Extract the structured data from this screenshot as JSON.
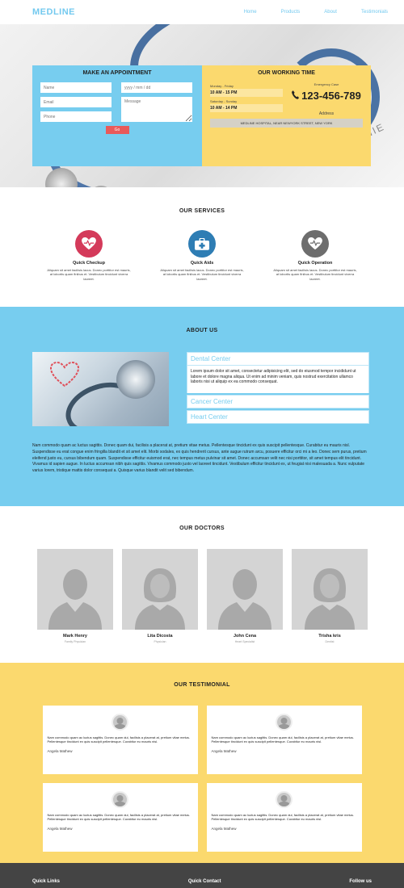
{
  "header": {
    "logo": "MEDLINE",
    "nav": [
      "Home",
      "Products",
      "About",
      "Testimonials"
    ]
  },
  "appointment": {
    "title": "MAKE AN APPOINTMENT",
    "name_placeholder": "Name",
    "date_placeholder": "yyyy / mm / dd",
    "email_placeholder": "Email",
    "message_placeholder": "Message",
    "phone_placeholder": "Phone",
    "submit_label": "Go"
  },
  "working": {
    "title": "OUR WORKING TIME",
    "weekday_label": "Monday - Friday",
    "weekday_time": "10 AM - 15 PM",
    "weekend_label": "Saturday - Sunday",
    "weekend_time": "10 AM - 14 PM",
    "emergency_label": "Emergency Case",
    "phone": "123-456-789",
    "address_label": "Address",
    "address": "MEDLINE HOSPITAL, NEAR NEWYORK STREET, NEW YORK",
    "photo_text": "ZAKAZIVANIE"
  },
  "services": {
    "title": "OUR SERVICES",
    "items": [
      {
        "title": "Quick Checkup",
        "text": "Aliquam sit amet facilisis lacus. Donec porttitor est mauris, at lobortis quam finibus et. Vestibulum tincidunt viverra laoreet.",
        "icon": "heart-icon",
        "color": "#d43a5a"
      },
      {
        "title": "Quick Aids",
        "text": "Aliquam sit amet facilisis lacus. Donec porttitor est mauris, at lobortis quam finibus et. Vestibulum tincidunt viverra laoreet.",
        "icon": "first-aid-icon",
        "color": "#2e7db4"
      },
      {
        "title": "Quick Operation",
        "text": "Aliquam sit amet facilisis lacus. Donec porttitor est mauris, at lobortis quam finibus et. Vestibulum tincidunt viverra laoreet.",
        "icon": "heartbeat-icon",
        "color": "#6d6d6d"
      }
    ]
  },
  "about": {
    "title": "ABOUT US",
    "accordion": [
      {
        "title": "Dental Center",
        "body": "Lorem ipsum dolor sit amet, consectetur adipisicing elit, sed do eiusmod tempor incididunt ut labore et dolore magna aliqua. Ut enim ad minim veniam, quis nostrud exercitation ullamco laboris nisi ut aliquip ex ea commodo consequat."
      },
      {
        "title": "Cancer Center"
      },
      {
        "title": "Heart Center"
      }
    ],
    "paragraph": "Nam commodo quam ac luctus sagittis. Donec quam dui, facilisis a placerat at, pretium vitae metus. Pellentesque tincidunt ex quis suscipit pellentesque. Curabitur eu mauris nisl. Suspendisse eu erat congue enim fringilla blandit et sit amet elit. Morbi sodales, ex quis hendrerit cursus, ante augue rutrum arcu, posuere efficitur orci mi a leo. Donec sem purus, pretium eleifend justo eu, cursus bibendum quam. Suspendisse efficitur euismod erat, nec tempus metus pulvinar sit amet. Donec accumsan velit nec nisi porttitor, sit amet tempus elit tincidunt. Vivamus id sapien augue. In luctus accumsan nibh quis sagittis. Vivamus commodo justo vel laoreet tincidunt. Vestibulum efficitur tincidunt ex, ut feugiat nisi malesuada a. Nunc vulputate varius lorem, tristique mattis dolor consequat a. Quisque varius blandit velit sed bibendum."
  },
  "doctors": {
    "title": "OUR DOCTORS",
    "items": [
      {
        "name": "Mark Henry",
        "role": "Family Physician",
        "gender": "male"
      },
      {
        "name": "Lita Dicosta",
        "role": "Physician",
        "gender": "female"
      },
      {
        "name": "John Cena",
        "role": "Heart Specialist",
        "gender": "male"
      },
      {
        "name": "Trisha kris",
        "role": "Dentist",
        "gender": "female"
      }
    ]
  },
  "testimonial": {
    "title": "OUR TESTIMONIAL",
    "items": [
      {
        "text": "Nam commodo quam ac luctus sagittis. Donec quam dui, facilisis a placerat at, pretium vitae metus. Pellentesque tincidunt ex quis suscipit pellentesque. Curabitur eu mauris nisl.",
        "name": "Angela Mathew"
      },
      {
        "text": "Nam commodo quam ac luctus sagittis. Donec quam dui, facilisis a placerat at, pretium vitae metus. Pellentesque tincidunt ex quis suscipit pellentesque. Curabitur eu mauris nisl.",
        "name": "Angela Mathew"
      },
      {
        "text": "Nam commodo quam ac luctus sagittis. Donec quam dui, facilisis a placerat at, pretium vitae metus. Pellentesque tincidunt ex quis suscipit pellentesque. Curabitur eu mauris nisl.",
        "name": "Angela Mathew"
      },
      {
        "text": "Nam commodo quam ac luctus sagittis. Donec quam dui, facilisis a placerat at, pretium vitae metus. Pellentesque tincidunt ex quis suscipit pellentesque. Curabitur eu mauris nisl.",
        "name": "Angela Mathew"
      }
    ]
  },
  "footer": {
    "columns": [
      "Quick Links",
      "Quick Contact",
      "Follow us"
    ]
  },
  "colors": {
    "accent_blue": "#77cdef",
    "accent_yellow": "#fbd96e",
    "button_red": "#e95a5a",
    "footer_dark": "#444444"
  }
}
